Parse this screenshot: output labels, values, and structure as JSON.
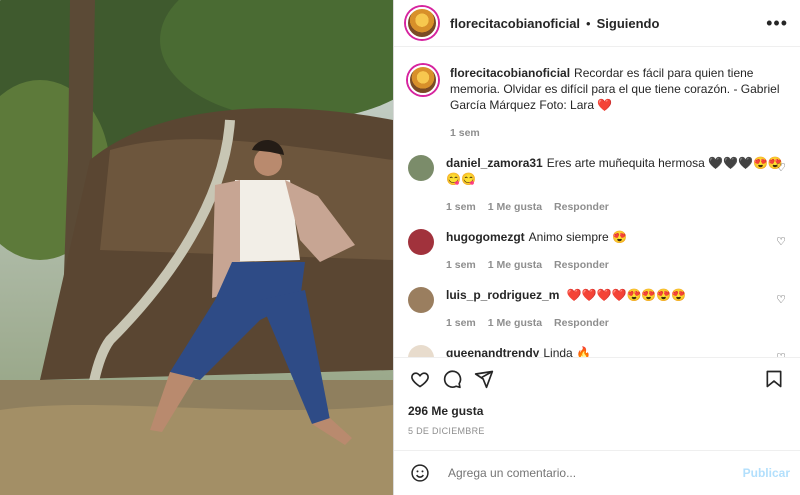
{
  "header": {
    "username": "florecitacobianoficial",
    "dot": "•",
    "follow": "Siguiendo",
    "more": "•••"
  },
  "caption": {
    "username": "florecitacobianoficial",
    "text": "Recordar es fácil para quien tiene memoria. Olvidar es difícil para el que tiene corazón. - Gabriel García Márquez Foto: Lara",
    "emoji": "❤️",
    "time": "1 sem"
  },
  "comments": [
    {
      "username": "daniel_zamora31",
      "text": "Eres arte muñequita hermosa",
      "emoji": "🖤🖤🖤😍😍 😋😋",
      "time": "1 sem",
      "likes": "1 Me gusta",
      "reply": "Responder",
      "avatar_color": "#7b8c6a"
    },
    {
      "username": "hugogomezgt",
      "text": "Animo siempre",
      "emoji": "😍",
      "time": "1 sem",
      "likes": "1 Me gusta",
      "reply": "Responder",
      "avatar_color": "#a1323c"
    },
    {
      "username": "luis_p_rodriguez_m",
      "text": "",
      "emoji": "❤️❤️❤️❤️😍😍😍😍",
      "time": "1 sem",
      "likes": "1 Me gusta",
      "reply": "Responder",
      "avatar_color": "#9a7e5f"
    },
    {
      "username": "queenandtrendy",
      "text": "Linda",
      "emoji": "🔥",
      "time": "",
      "likes": "",
      "reply": "",
      "avatar_color": "#e8dccd"
    }
  ],
  "likes": "296 Me gusta",
  "date": "5 DE DICIEMBRE",
  "composer": {
    "placeholder": "Agrega un comentario...",
    "post": "Publicar"
  },
  "colors": {
    "accent": "#0095f6",
    "post_disabled": "#b2dffc",
    "heart": "#ed4956"
  },
  "icons": [
    "heart-icon",
    "comment-icon",
    "share-icon",
    "bookmark-icon",
    "emoji-icon",
    "more-icon"
  ]
}
